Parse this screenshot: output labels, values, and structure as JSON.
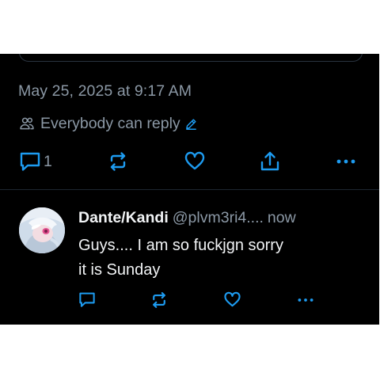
{
  "post": {
    "timestamp": "May 25, 2025 at 9:17 AM",
    "reply_setting": "Everybody can reply",
    "reply_count": "1"
  },
  "reply": {
    "display_name": "Dante/Kandi",
    "handle": "@plvm3ri4....",
    "time": "now",
    "text_line1": "Guys.... I am so fuckjgn sorry",
    "text_line2": "it is Sunday"
  },
  "icons": {
    "reply_setting": "people-icon",
    "edit": "pencil-icon",
    "reply": "comment-icon",
    "repost": "repost-icon",
    "like": "heart-icon",
    "share": "share-icon",
    "more": "more-icon"
  },
  "colors": {
    "background": "#000000",
    "text_primary": "#f1f3f5",
    "text_secondary": "#8b98a5",
    "accent": "#1d9bf0"
  }
}
